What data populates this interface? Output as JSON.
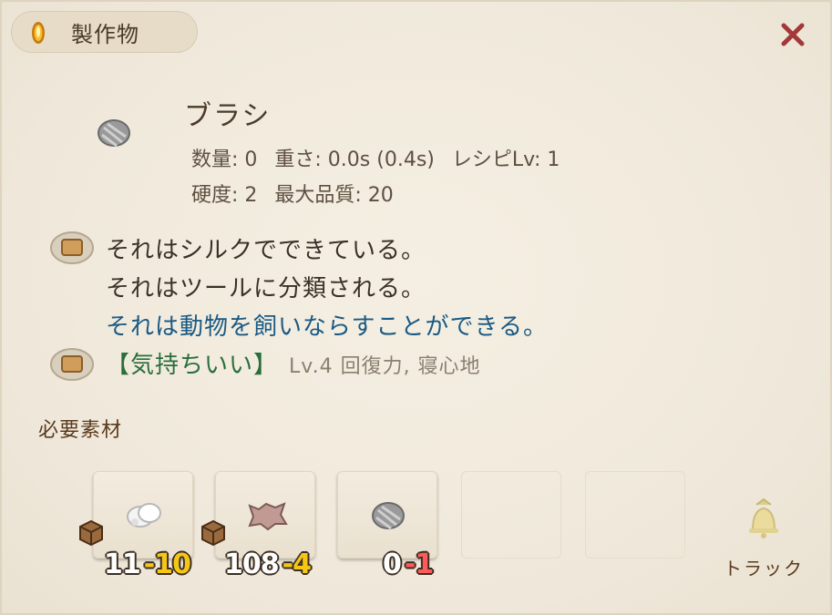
{
  "window": {
    "title": "製作物",
    "close_symbol": "✕"
  },
  "item": {
    "name": "ブラシ",
    "stats_row1": [
      "数量: 0",
      "重さ: 0.0s (0.4s)",
      "レシピLv: 1"
    ],
    "stats_row2": [
      "硬度: 2",
      "最大品質: 20"
    ],
    "icon": "brush-icon"
  },
  "description": {
    "lines": [
      "それはシルクでできている。",
      "それはツールに分類される。",
      "それは動物を飼いならすことができる。"
    ],
    "trait": {
      "name": "【気持ちいい】",
      "detail": "Lv.4 回復力, 寝心地"
    }
  },
  "materials": {
    "header": "必要素材",
    "slots": [
      {
        "icon": "silk-icon",
        "have": "11",
        "need": "-10",
        "need_color": "#f5c518"
      },
      {
        "icon": "hide-icon",
        "have": "108",
        "need": "-4",
        "need_color": "#f5c518"
      },
      {
        "icon": "brush-icon",
        "have": "0",
        "need": "-1",
        "need_color": "#ff5a5a"
      }
    ]
  },
  "track": {
    "label": "トラック",
    "icon": "bell-icon"
  },
  "colors": {
    "title_text": "#4a3a2a",
    "close": "#a3383a",
    "blue_text": "#1a5a84",
    "trait_green": "#2a6e3c"
  }
}
